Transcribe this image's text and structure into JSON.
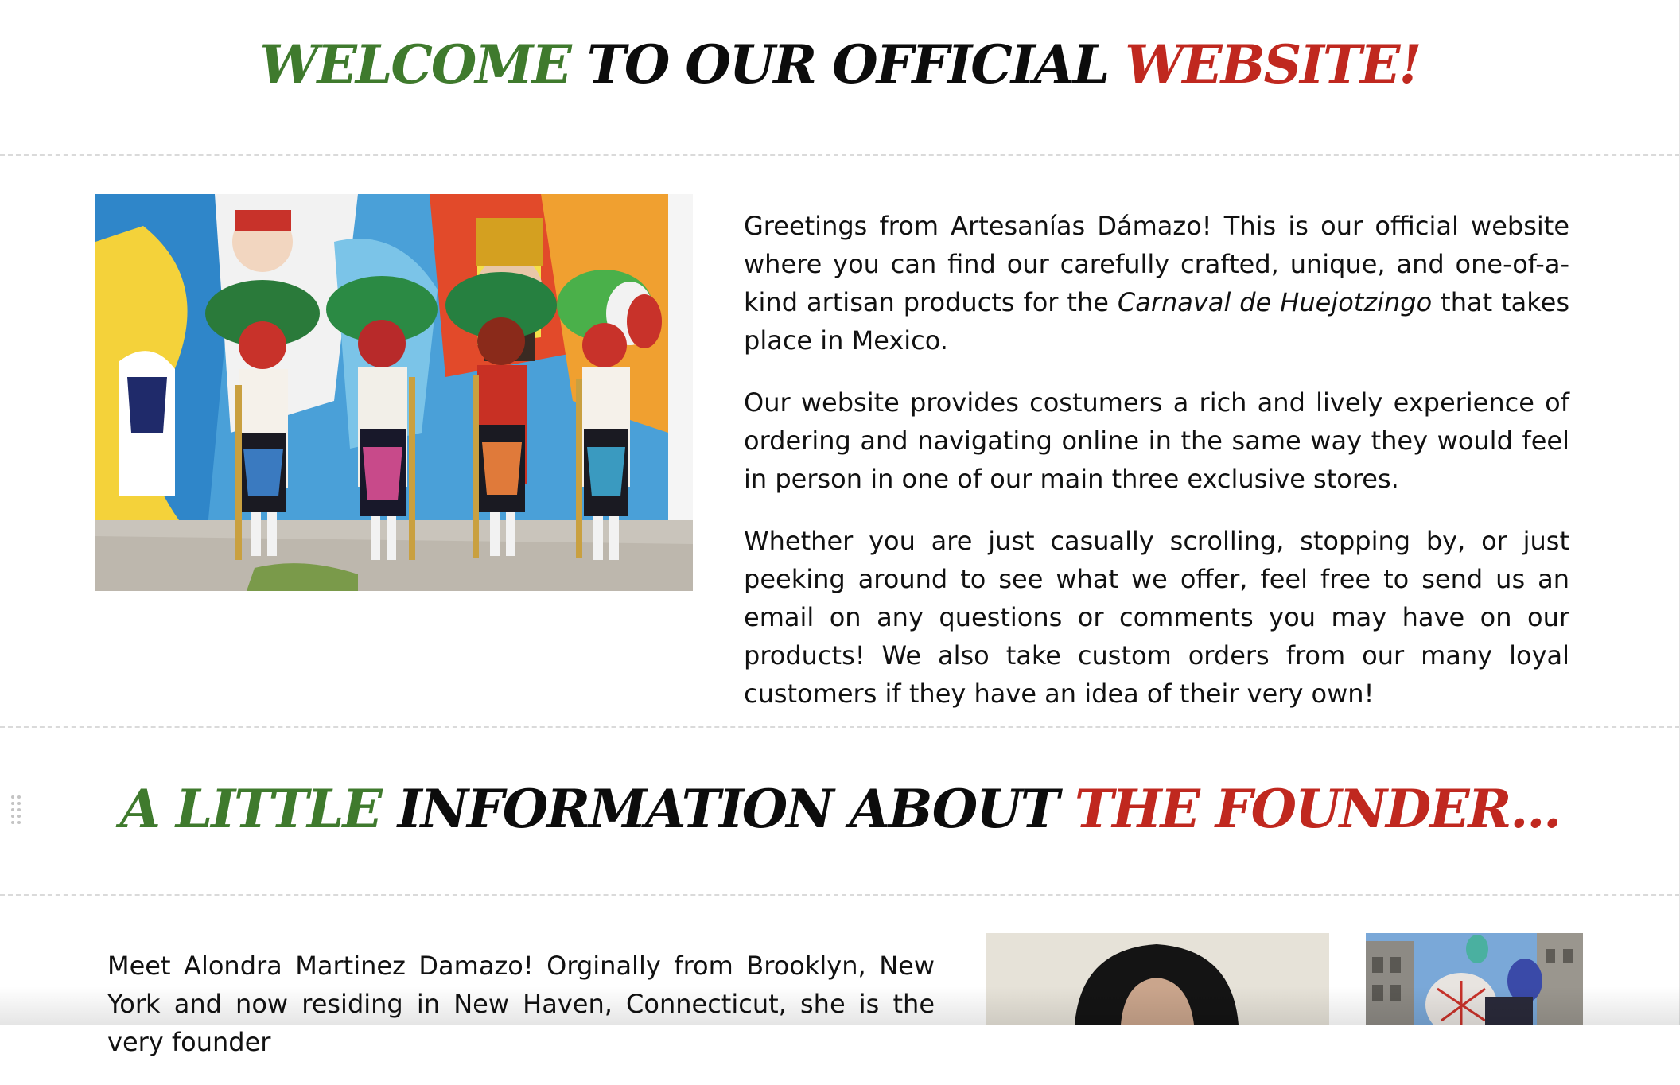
{
  "welcome_heading": {
    "part1": "WELCOME",
    "part2": "TO OUR OFFICIAL",
    "part3": "WEBSITE!"
  },
  "intro": {
    "p1_before": "Greetings from Artesanías Dámazo! This is our official website where you can find our carefully crafted, unique, and one-of-a-kind artisan products for the ",
    "p1_italic": "Carnaval de Huejotzingo",
    "p1_after": " that takes place in Mexico.",
    "p2": "Our website provides costumers a rich and lively experience of ordering and navigating online in the same way they would feel in person in one of our main three exclusive stores.",
    "p3": "Whether you are just casually scrolling, stopping by, or just peeking around to see what we offer, feel free to send us an email on any questions or comments you may have on our products! We also take custom orders from our many loyal customers if they have an idea of their very own!"
  },
  "founder_heading": {
    "part1": "A LITTLE",
    "part2": "INFORMATION ABOUT",
    "part3": "THE FOUNDER..."
  },
  "founder": {
    "text": "Meet Alondra Martinez Damazo! Orginally from Brooklyn, New York and now residing in New Haven, Connecticut, she is the very founder"
  },
  "colors": {
    "green": "#3f7a2d",
    "red": "#c0281f",
    "black": "#0c0c0c"
  },
  "icons": {
    "drag_handle": "drag-handle-icon"
  }
}
